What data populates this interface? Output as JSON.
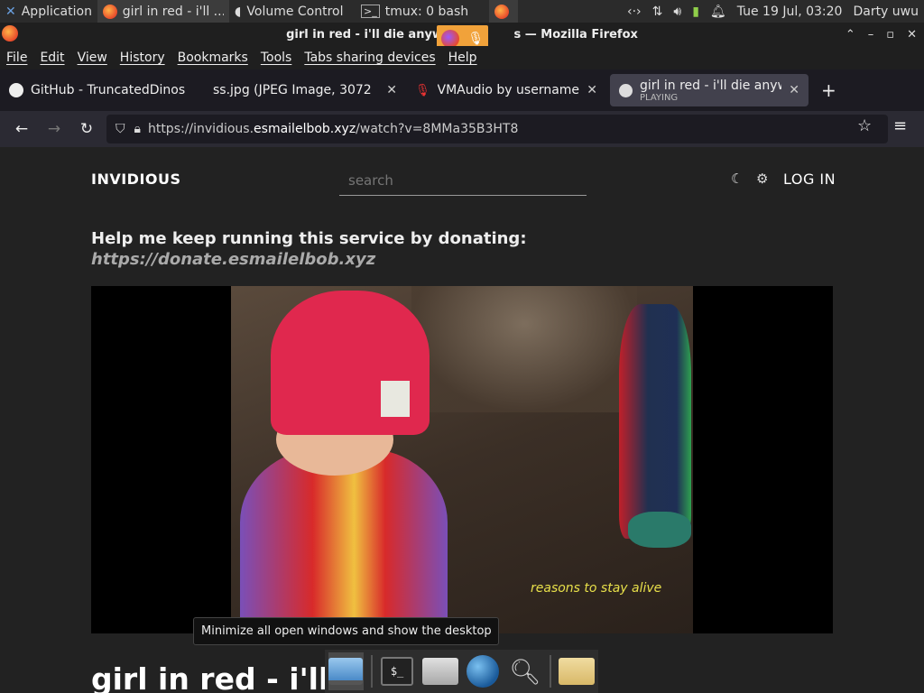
{
  "panel": {
    "apps_label": "Applications",
    "tasks": [
      {
        "label": "girl in red - i'll ...",
        "icon": "firefox-icon"
      },
      {
        "label": "Volume Control",
        "icon": "volume-control-icon"
      },
      {
        "label": "tmux: 0 bash",
        "icon": "terminal-icon"
      }
    ],
    "clock": "Tue 19 Jul, 03:20",
    "user": "Darty uwu"
  },
  "window": {
    "title": "girl in red - i'll die anyway. - ",
    "title_tail": "s — Mozilla Firefox"
  },
  "menubar": {
    "items": [
      "File",
      "Edit",
      "View",
      "History",
      "Bookmarks",
      "Tools",
      "Tabs sharing devices",
      "Help"
    ]
  },
  "tabs": [
    {
      "label": "GitHub - TruncatedDinos",
      "icon": "github-icon"
    },
    {
      "label": "ss.jpg (JPEG Image, 3072",
      "icon": ""
    },
    {
      "label": "VMAudio by usernamee",
      "icon": "microphone-icon"
    },
    {
      "label": "girl in red - i'll die anyway",
      "sub": "PLAYING",
      "icon": "invidious-icon"
    }
  ],
  "navbar": {
    "url_prefix": "https://invidious.",
    "url_host": "esmailelbob.xyz",
    "url_path": "/watch?v=8MMa35B3HT8"
  },
  "page": {
    "site_name": "INVIDIOUS",
    "search_placeholder": "search",
    "login_label": "LOG IN",
    "donate_title": "Help me keep running this service by donating:",
    "donate_link": "https://donate.esmailelbob.xyz",
    "video_caption": "reasons to stay alive",
    "video_title": "girl in red - i'll"
  },
  "tooltip": "Minimize all open windows and show the desktop",
  "colors": {
    "accent": "#f1a23a",
    "page_bg": "#222222",
    "caption": "#e8e04a"
  }
}
